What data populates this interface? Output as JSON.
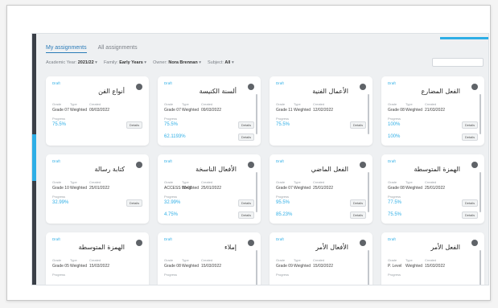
{
  "tabs": [
    "My assignments",
    "All assignments"
  ],
  "filters": [
    {
      "label": "Academic Year:",
      "value": "2021/22"
    },
    {
      "label": "Family:",
      "value": "Early Years"
    },
    {
      "label": "Owner:",
      "value": "Nora Brennan"
    },
    {
      "label": "Subject:",
      "value": "All"
    }
  ],
  "meta_headers": [
    "Grade",
    "Type",
    "Created"
  ],
  "progress_label": "Progress",
  "cards": [
    {
      "status": "Draft",
      "title": "أنواع الفن",
      "grade": "Grade 07",
      "type": "Weighted",
      "created": "09/03/2022",
      "progress": "75.5%",
      "submitted": "",
      "badge": "Details"
    },
    {
      "status": "Draft",
      "title": "ألسنة الكنيسة",
      "grade": "Grade 07",
      "type": "Weighted",
      "created": "09/03/2022",
      "progress": "75.5%",
      "submitted": "62.1193%",
      "badge": "Details"
    },
    {
      "status": "Draft",
      "title": "الأعمال الفنية",
      "grade": "Grade 11",
      "type": "Weighted",
      "created": "12/02/2022",
      "progress": "75.5%",
      "submitted": "",
      "badge": "Details"
    },
    {
      "status": "Draft",
      "title": "الفعل المضارع",
      "grade": "Grade 08",
      "type": "Weighted",
      "created": "21/03/2022",
      "progress": "100%",
      "submitted": "100%",
      "badge": "Details"
    },
    {
      "status": "Draft",
      "title": "كتابة رسالة",
      "grade": "Grade 10",
      "type": "Weighted",
      "created": "25/01/2022",
      "progress": "32.99%",
      "submitted": "",
      "badge": "Details"
    },
    {
      "status": "Draft",
      "title": "الأفعال الناسخة",
      "grade": "ACCESS 10-01",
      "type": "Weighted",
      "created": "25/01/2022",
      "progress": "32.99%",
      "submitted": "4.75%",
      "badge": "Details"
    },
    {
      "status": "Draft",
      "title": "الفعل الماضي",
      "grade": "Grade 07",
      "type": "Weighted",
      "created": "25/01/2022",
      "progress": "95.5%",
      "submitted": "85.23%",
      "badge": "Details"
    },
    {
      "status": "Draft",
      "title": "الهمزة المتوسطة",
      "grade": "Grade 08",
      "type": "Weighted",
      "created": "25/01/2022",
      "progress": "77.5%",
      "submitted": "75.5%",
      "badge": "Details"
    },
    {
      "status": "Draft",
      "title": "الهمزة المتوسطة",
      "grade": "Grade 05",
      "type": "Weighted",
      "created": "15/03/2022",
      "progress": "",
      "submitted": "",
      "badge": ""
    },
    {
      "status": "Draft",
      "title": "إملاء",
      "grade": "Grade 08",
      "type": "Weighted",
      "created": "15/03/2022",
      "progress": "",
      "submitted": "",
      "badge": ""
    },
    {
      "status": "Draft",
      "title": "الأفعال الأمر",
      "grade": "Grade 09",
      "type": "Weighted",
      "created": "15/03/2022",
      "progress": "",
      "submitted": "",
      "badge": ""
    },
    {
      "status": "Draft",
      "title": "الفعل الأمر",
      "grade": "P. Level",
      "type": "Weighted",
      "created": "15/03/2022",
      "progress": "",
      "submitted": "",
      "badge": ""
    }
  ]
}
